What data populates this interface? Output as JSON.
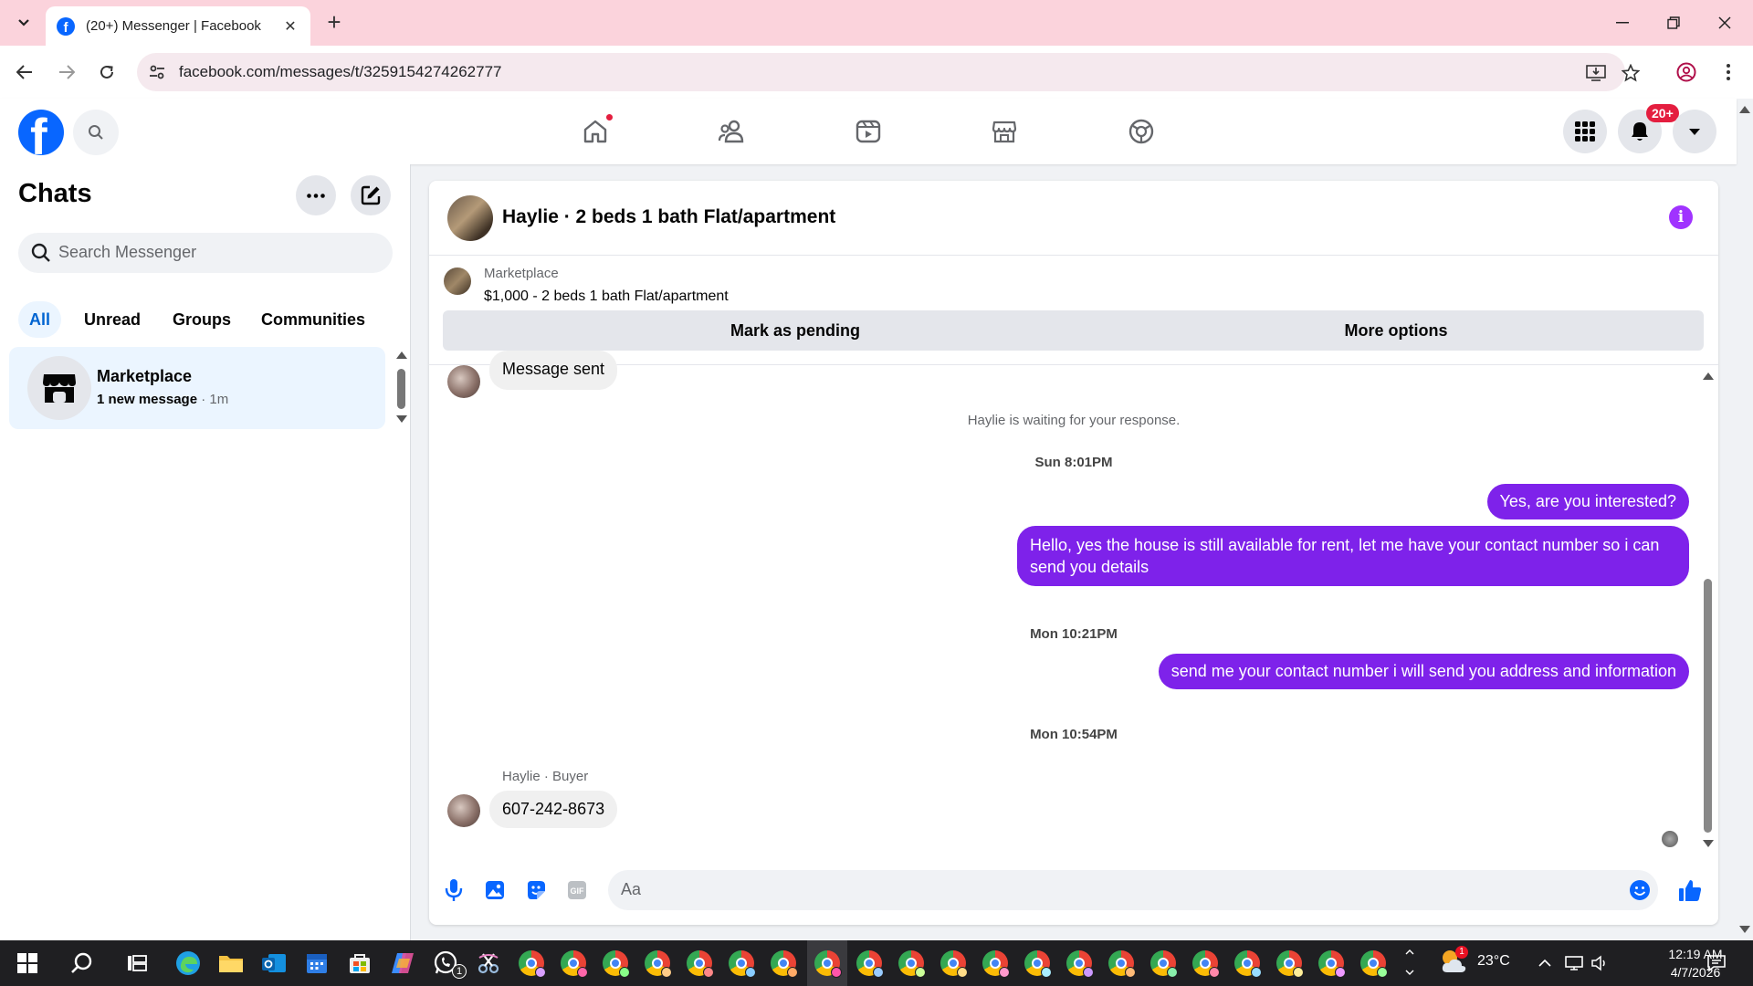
{
  "browser": {
    "tab_title": "(20+) Messenger | Facebook",
    "url": "facebook.com/messages/t/3259154274262777"
  },
  "header": {
    "notification_badge": "20+"
  },
  "chats": {
    "title": "Chats",
    "search_placeholder": "Search Messenger",
    "filters": [
      "All",
      "Unread",
      "Groups",
      "Communities"
    ],
    "items": [
      {
        "name": "Marketplace",
        "preview": "1 new message",
        "time": "1m"
      }
    ]
  },
  "conversation": {
    "title": "Haylie · 2 beds 1 bath Flat/apartment",
    "listing": {
      "label": "Marketplace",
      "price_title": "$1,000 - 2 beds 1 bath Flat/apartment",
      "pending_button": "Mark as pending",
      "options_button": "More options"
    },
    "messages": {
      "sent_status_partial": "Message sent",
      "waiting": "Haylie is waiting for your response.",
      "ts1": "Sun 8:01PM",
      "out1": "Yes, are you interested?",
      "out2": "Hello, yes the house is still available for rent, let me have your contact number so i can send you details",
      "ts2": "Mon 10:21PM",
      "out3": "send me your contact number i will send you address and information",
      "ts3": "Mon 10:54PM",
      "sender": "Haylie · Buyer",
      "in1": "607-242-8673"
    },
    "composer_placeholder": "Aa"
  },
  "taskbar": {
    "weather": "23°C",
    "time": "12:19 AM",
    "date": "4/7/2026",
    "whatsapp_badge": "1",
    "weather_badge": "1"
  },
  "colors": {
    "fb_blue": "#0866ff",
    "messenger_purple": "#7e22ea",
    "notification_red": "#e41e3f",
    "tab_bar_pink": "#fbd3dc"
  }
}
